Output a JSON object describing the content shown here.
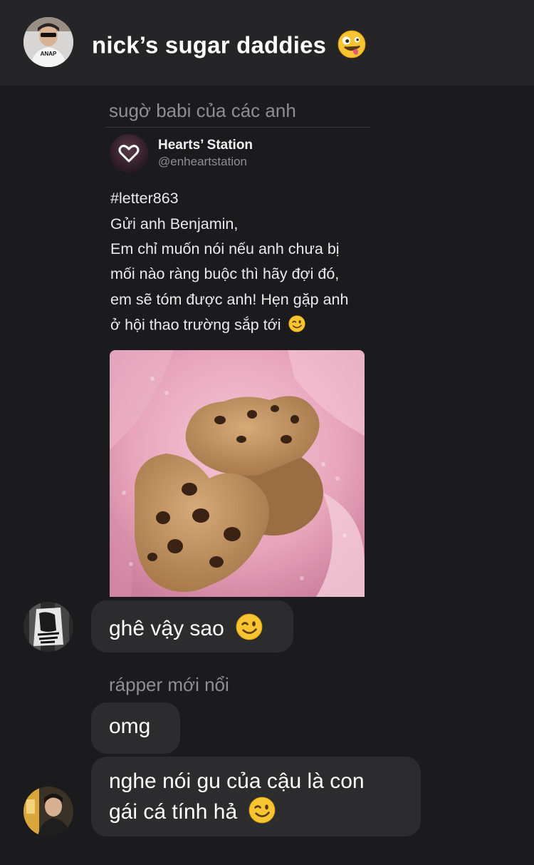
{
  "header": {
    "title": "nick’s sugar daddies",
    "title_emoji": "zany-face-emoji",
    "avatar_shirt_text": "ANAP"
  },
  "messages": [
    {
      "sender": "sugờ babi của các anh",
      "type": "shared-post",
      "post": {
        "account_name": "Hearts’ Station",
        "account_handle": "@enheartstation",
        "lines": [
          "#letter863",
          "Gửi anh Benjamin,",
          "Em chỉ muốn nói nếu anh chưa bị",
          "mối nào ràng buộc thì hãy đợi đó,",
          "em sẽ tóm được anh! Hẹn gặp anh",
          "ở hội thao trường sắp tới"
        ],
        "image": "heart-shaped-cookies-photo"
      }
    },
    {
      "type": "text",
      "text": "ghê vậy sao",
      "emoji": "winking-face-emoji"
    },
    {
      "sender": "rápper mới nổi",
      "type": "text",
      "text": "omg"
    },
    {
      "type": "text",
      "lines": [
        "nghe nói gu của cậu là con",
        "gái cá tính hả"
      ],
      "emoji": "winking-face-emoji"
    }
  ],
  "colors": {
    "background": "#1b1b1d",
    "header": "#252527",
    "bubble": "#2c2c2e",
    "secondary_text": "#8e8e93"
  }
}
